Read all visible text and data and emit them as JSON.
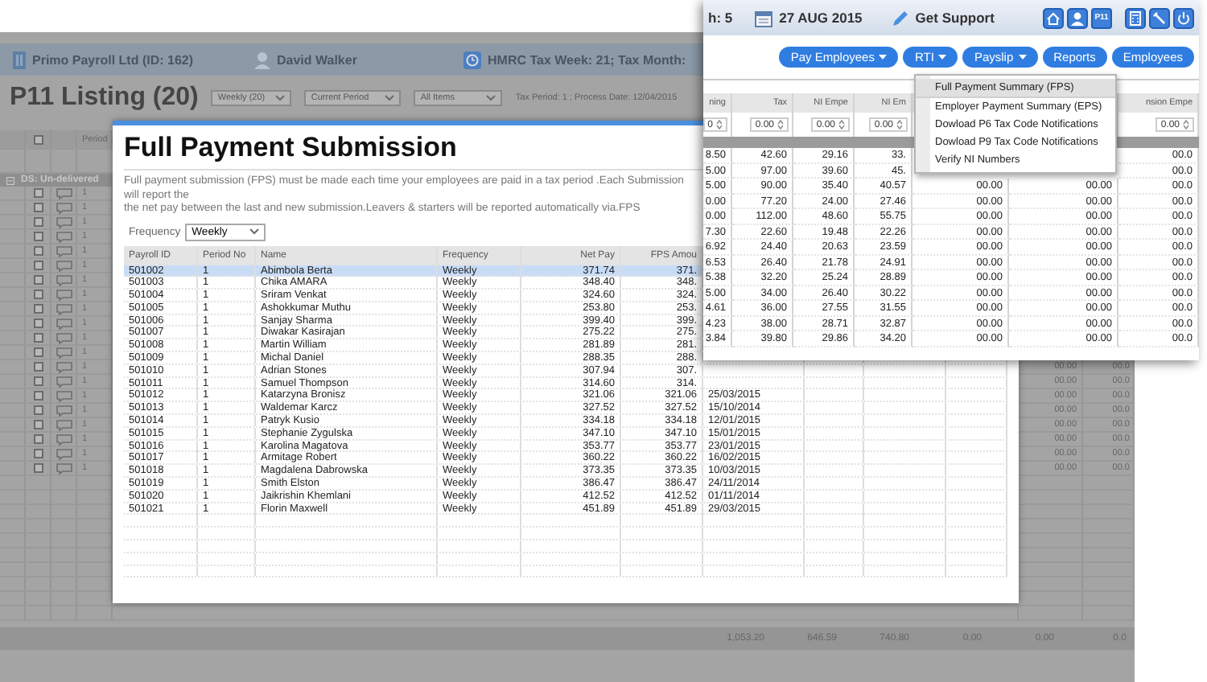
{
  "background": {
    "header": {
      "company": "Primo Payroll Ltd (ID: 162)",
      "user": "David Walker",
      "tax_week": "HMRC Tax Week: 21; Tax Month:"
    },
    "title": "P11 Listing (20)",
    "filters": [
      "Weekly (20)",
      "Current Period",
      "All Items"
    ],
    "info": "Tax Period: 1 ; Process Date: 12/04/2015",
    "table": {
      "header_checked": false,
      "period_header": "Period",
      "group": "DS: Un-delivered",
      "rows": [
        {
          "checked": false,
          "period": "1"
        },
        {
          "checked": false,
          "period": "1"
        },
        {
          "checked": false,
          "period": "1"
        },
        {
          "checked": false,
          "period": "1"
        },
        {
          "checked": false,
          "period": "1"
        },
        {
          "checked": false,
          "period": "1"
        },
        {
          "checked": false,
          "period": "1"
        },
        {
          "checked": false,
          "period": "1"
        },
        {
          "checked": false,
          "period": "1"
        },
        {
          "checked": false,
          "period": "1"
        },
        {
          "checked": false,
          "period": "1"
        },
        {
          "checked": false,
          "period": "1"
        },
        {
          "checked": false,
          "period": "1",
          "tail": [
            "00.00",
            "00.0"
          ]
        },
        {
          "checked": false,
          "period": "1",
          "tail": [
            "00.00",
            "00.0"
          ]
        },
        {
          "checked": false,
          "period": "1",
          "tail": [
            "00.00",
            "00.0"
          ]
        },
        {
          "checked": false,
          "period": "1",
          "tail": [
            "00.00",
            "00.0"
          ]
        },
        {
          "checked": false,
          "period": "1",
          "tail": [
            "00.00",
            "00.0"
          ]
        },
        {
          "checked": false,
          "period": "1",
          "tail": [
            "00.00",
            "00.0"
          ]
        },
        {
          "checked": false,
          "period": "1",
          "tail": [
            "00.00",
            "00.0"
          ]
        },
        {
          "checked": false,
          "period": "1",
          "tail": [
            "00.00",
            "00.0"
          ]
        }
      ],
      "totals": [
        "1,053.20",
        "646.59",
        "740.80",
        "0.00",
        "0.00",
        "0.0"
      ]
    }
  },
  "dialog": {
    "title": "Full Payment Submission",
    "description_lines": [
      "Full payment submission (FPS) must be made each time your employees are paid in a tax period .Each Submission will report the",
      "the net pay between the last and new submission.Leavers & starters will be reported automatically via.FPS"
    ],
    "frequency_label": "Frequency",
    "frequency_value": "Weekly",
    "columns": [
      "Payroll ID",
      "Period No",
      "Name",
      "Frequency",
      "Net Pay",
      "FPS Amou"
    ],
    "rows": [
      {
        "selected": true,
        "cells": [
          "501002",
          "1",
          "Abimbola Berta",
          "Weekly",
          "371.74",
          "371."
        ]
      },
      {
        "selected": false,
        "cells": [
          "501003",
          "1",
          "Chika AMARA",
          "Weekly",
          "348.40",
          "348."
        ]
      },
      {
        "selected": false,
        "cells": [
          "501004",
          "1",
          "Sriram Venkat",
          "Weekly",
          "324.60",
          "324."
        ]
      },
      {
        "selected": false,
        "cells": [
          "501005",
          "1",
          "Ashokkumar Muthu",
          "Weekly",
          "253.80",
          "253."
        ]
      },
      {
        "selected": false,
        "cells": [
          "501006",
          "1",
          "Sanjay Sharma",
          "Weekly",
          "399.40",
          "399."
        ]
      },
      {
        "selected": false,
        "cells": [
          "501007",
          "1",
          "Diwakar Kasirajan",
          "Weekly",
          "275.22",
          "275."
        ]
      },
      {
        "selected": false,
        "cells": [
          "501008",
          "1",
          "Martin William",
          "Weekly",
          "281.89",
          "281."
        ]
      },
      {
        "selected": false,
        "cells": [
          "501009",
          "1",
          "Michal Daniel",
          "Weekly",
          "288.35",
          "288."
        ]
      },
      {
        "selected": false,
        "cells": [
          "501010",
          "1",
          "Adrian Stones",
          "Weekly",
          "307.94",
          "307."
        ]
      },
      {
        "selected": false,
        "cells": [
          "501011",
          "1",
          "Samuel Thompson",
          "Weekly",
          "314.60",
          "314."
        ]
      },
      {
        "selected": false,
        "cells": [
          "501012",
          "1",
          "Katarzyna Bronisz",
          "Weekly",
          "321.06",
          "321.06",
          "25/03/2015"
        ]
      },
      {
        "selected": false,
        "cells": [
          "501013",
          "1",
          "Waldemar Karcz",
          "Weekly",
          "327.52",
          "327.52",
          "15/10/2014"
        ]
      },
      {
        "selected": false,
        "cells": [
          "501014",
          "1",
          "Patryk Kusio",
          "Weekly",
          "334.18",
          "334.18",
          "12/01/2015"
        ]
      },
      {
        "selected": false,
        "cells": [
          "501015",
          "1",
          "Stephanie Zygulska",
          "Weekly",
          "347.10",
          "347.10",
          "15/01/2015"
        ]
      },
      {
        "selected": false,
        "cells": [
          "501016",
          "1",
          "Karolina Magatova",
          "Weekly",
          "353.77",
          "353.77",
          "23/01/2015"
        ]
      },
      {
        "selected": false,
        "cells": [
          "501017",
          "1",
          "Armitage Robert",
          "Weekly",
          "360.22",
          "360.22",
          "16/02/2015"
        ]
      },
      {
        "selected": false,
        "cells": [
          "501018",
          "1",
          "Magdalena Dabrowska",
          "Weekly",
          "373.35",
          "373.35",
          "10/03/2015"
        ]
      },
      {
        "selected": false,
        "cells": [
          "501019",
          "1",
          "Smith Elston",
          "Weekly",
          "386.47",
          "386.47",
          "24/11/2014"
        ]
      },
      {
        "selected": false,
        "cells": [
          "501020",
          "1",
          "Jaikrishin Khemlani",
          "Weekly",
          "412.52",
          "412.52",
          "01/11/2014"
        ]
      },
      {
        "selected": false,
        "cells": [
          "501021",
          "1",
          "Florin Maxwell",
          "Weekly",
          "451.89",
          "451.89",
          "29/03/2015"
        ]
      }
    ]
  },
  "front": {
    "tax_month": "h: 5",
    "date": "27 AUG 2015",
    "support": "Get Support",
    "badge": "P11",
    "nav": [
      {
        "label": "Pay Employees",
        "kind": "dropdown"
      },
      {
        "label": "RTI",
        "kind": "dropdown"
      },
      {
        "label": "Payslip",
        "kind": "dropdown"
      },
      {
        "label": "Reports",
        "kind": "plain"
      },
      {
        "label": "Employees",
        "kind": "plain"
      }
    ],
    "menu": [
      {
        "label": "Full Payment Summary (FPS)",
        "selected": true
      },
      {
        "label": "Employer Payment Summary (EPS)",
        "selected": false
      },
      {
        "label": "Dowload P6 Tax Code Notifications",
        "selected": false
      },
      {
        "label": "Dowload P9 Tax Code Notifications",
        "selected": false
      },
      {
        "label": "Verify NI Numbers",
        "selected": false
      }
    ],
    "columns": [
      {
        "label": "ning",
        "filter": "0"
      },
      {
        "label": "Tax",
        "filter": "0.00"
      },
      {
        "label": "NI Empe",
        "filter": "0.00"
      },
      {
        "label": "NI Em",
        "filter": "0.00"
      },
      {},
      {},
      {
        "label": "nsion Empe",
        "filter": "0.00"
      }
    ],
    "rows": [
      {
        "cells": [
          "8.50",
          "42.60",
          "29.16",
          "33.",
          null,
          null,
          "00.0"
        ]
      },
      {
        "cells": [
          "5.00",
          "97.00",
          "39.60",
          "45.",
          null,
          null,
          "00.0"
        ]
      },
      {
        "cells": [
          "5.00",
          "90.00",
          "35.40",
          "40.57",
          "00.00",
          "00.00",
          "00.0"
        ]
      },
      {
        "cells": [
          "0.00",
          "77.20",
          "24.00",
          "27.46",
          "00.00",
          "00.00",
          "00.0"
        ]
      },
      {
        "cells": [
          "0.00",
          "112.00",
          "48.60",
          "55.75",
          "00.00",
          "00.00",
          "00.0"
        ]
      },
      {
        "cells": [
          "7.30",
          "22.60",
          "19.48",
          "22.26",
          "00.00",
          "00.00",
          "00.0"
        ]
      },
      {
        "cells": [
          "6.92",
          "24.40",
          "20.63",
          "23.59",
          "00.00",
          "00.00",
          "00.0"
        ]
      },
      {
        "cells": [
          "6.53",
          "26.40",
          "21.78",
          "24.91",
          "00.00",
          "00.00",
          "00.0"
        ]
      },
      {
        "cells": [
          "5.38",
          "32.20",
          "25.24",
          "28.89",
          "00.00",
          "00.00",
          "00.0"
        ]
      },
      {
        "cells": [
          "5.00",
          "34.00",
          "26.40",
          "30.22",
          "00.00",
          "00.00",
          "00.0"
        ]
      },
      {
        "cells": [
          "4.61",
          "36.00",
          "27.55",
          "31.55",
          "00.00",
          "00.00",
          "00.0"
        ]
      },
      {
        "cells": [
          "4.23",
          "38.00",
          "28.71",
          "32.87",
          "00.00",
          "00.00",
          "00.0"
        ]
      },
      {
        "cells": [
          "3.84",
          "39.80",
          "29.86",
          "34.20",
          "00.00",
          "00.00",
          "00.0"
        ]
      }
    ]
  }
}
